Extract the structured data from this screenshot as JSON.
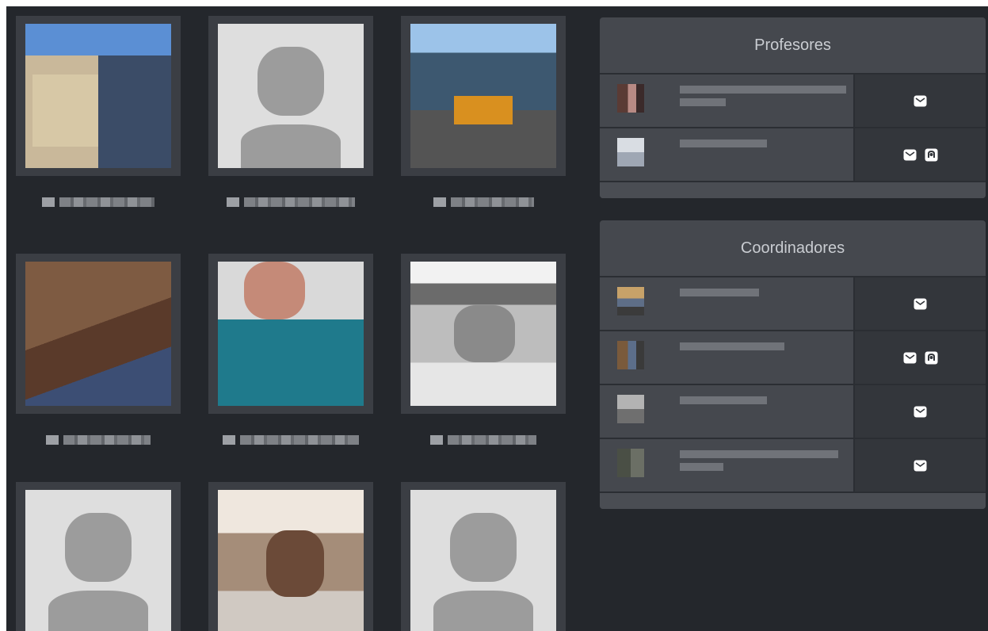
{
  "profesores": {
    "title": "Profesores",
    "members": [
      {
        "contact": [
          "envelope-icon"
        ]
      },
      {
        "contact": [
          "envelope-icon",
          "github-icon"
        ]
      }
    ]
  },
  "coordinadores": {
    "title": "Coordinadores",
    "members": [
      {
        "contact": [
          "envelope-icon"
        ]
      },
      {
        "contact": [
          "envelope-icon",
          "github-icon"
        ]
      },
      {
        "contact": [
          "envelope-icon"
        ]
      },
      {
        "contact": [
          "envelope-icon"
        ]
      }
    ]
  },
  "colors": {
    "background": "#24272c",
    "panel": "#45484e",
    "panel_title_text": "#c9ccd1",
    "icon": "#ffffff"
  }
}
